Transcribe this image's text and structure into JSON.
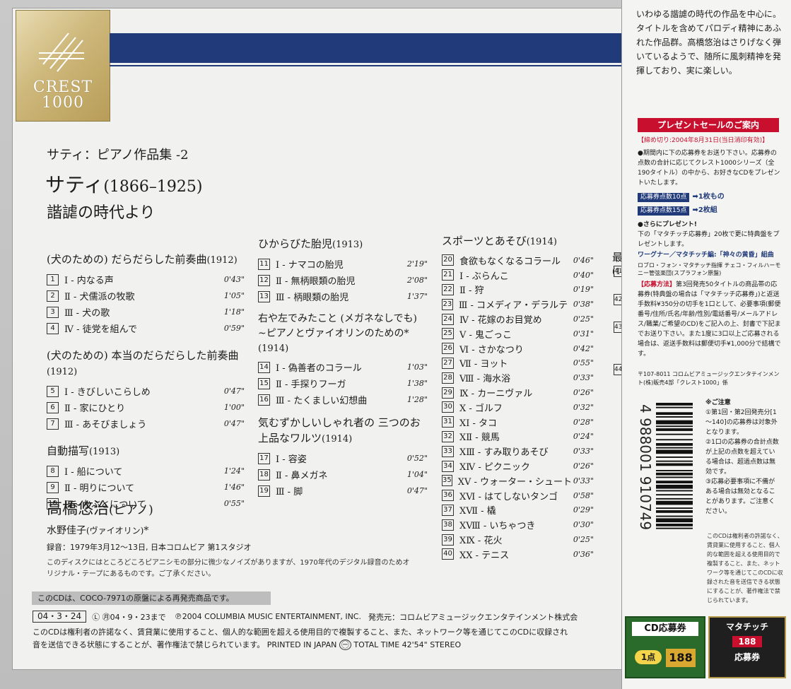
{
  "logo": {
    "line1": "CREST",
    "line2": "1000"
  },
  "album": {
    "series_title": "サティ：ピアノ作品集 -2",
    "composer": "サティ",
    "years": "(1866–1925)",
    "title": "諧謔の時代より"
  },
  "columns": [
    {
      "works": [
        {
          "title": "(犬のための) だらだらした前奏曲",
          "year": "(1912)",
          "tracks": [
            {
              "num": "1",
              "name": "Ⅰ - 内なる声",
              "time": "0'43\""
            },
            {
              "num": "2",
              "name": "Ⅱ - 犬儒派の牧歌",
              "time": "1'05\""
            },
            {
              "num": "3",
              "name": "Ⅲ - 犬の歌",
              "time": "1'18\""
            },
            {
              "num": "4",
              "name": "Ⅳ - 徒党を組んで",
              "time": "0'59\""
            }
          ]
        },
        {
          "title": "(犬のための) 本当のだらだらした前奏曲",
          "year": "(1912)",
          "tracks": [
            {
              "num": "5",
              "name": "Ⅰ - きびしいこらしめ",
              "time": "0'47\""
            },
            {
              "num": "6",
              "name": "Ⅱ - 家にひとり",
              "time": "1'00\""
            },
            {
              "num": "7",
              "name": "Ⅲ - あそびましょう",
              "time": "0'47\""
            }
          ]
        },
        {
          "title": "自動描写",
          "year": "(1913)",
          "tracks": [
            {
              "num": "8",
              "name": "Ⅰ - 船について",
              "time": "1'24\""
            },
            {
              "num": "9",
              "name": "Ⅱ - 明りについて",
              "time": "1'46\""
            },
            {
              "num": "10",
              "name": "Ⅲ - かぶとについて",
              "time": "0'55\""
            }
          ]
        }
      ]
    },
    {
      "works": [
        {
          "title": "ひからびた胎児",
          "year": "(1913)",
          "tracks": [
            {
              "num": "11",
              "name": "Ⅰ - ナマコの胎児",
              "time": "2'19\""
            },
            {
              "num": "12",
              "name": "Ⅱ - 無柄眼類の胎児",
              "time": "2'08\""
            },
            {
              "num": "13",
              "name": "Ⅲ - 柄眼類の胎児",
              "time": "1'37\""
            }
          ]
        },
        {
          "title": "右や左でみたこと (メガネなしでも) ~ピアノとヴァイオリンのための*",
          "year": "(1914)",
          "tracks": [
            {
              "num": "14",
              "name": "Ⅰ - 偽善者のコラール",
              "time": "1'03\""
            },
            {
              "num": "15",
              "name": "Ⅱ - 手探りフーガ",
              "time": "1'38\""
            },
            {
              "num": "16",
              "name": "Ⅲ - たくましい幻想曲",
              "time": "1'28\""
            }
          ]
        },
        {
          "title": "気むずかしいしゃれ者の 三つのお上品なワルツ",
          "year": "(1914)",
          "tracks": [
            {
              "num": "17",
              "name": "Ⅰ - 容姿",
              "time": "0'52\""
            },
            {
              "num": "18",
              "name": "Ⅱ - 鼻メガネ",
              "time": "1'04\""
            },
            {
              "num": "19",
              "name": "Ⅲ - 脚",
              "time": "0'47\""
            }
          ]
        }
      ]
    },
    {
      "works": [
        {
          "title": "スポーツとあそび",
          "year": "(1914)",
          "tracks": [
            {
              "num": "20",
              "name": "食欲もなくなるコラール",
              "time": "0'46\""
            },
            {
              "num": "21",
              "name": "Ⅰ - ぶらんこ",
              "time": "0'40\""
            },
            {
              "num": "22",
              "name": "Ⅱ - 狩",
              "time": "0'19\""
            },
            {
              "num": "23",
              "name": "Ⅲ - コメディア・デラルテ",
              "time": "0'38\""
            },
            {
              "num": "24",
              "name": "Ⅳ - 花嫁のお目覚め",
              "time": "0'25\""
            },
            {
              "num": "25",
              "name": "Ⅴ - 鬼ごっこ",
              "time": "0'31\""
            },
            {
              "num": "26",
              "name": "Ⅵ - さかなつり",
              "time": "0'42\""
            },
            {
              "num": "27",
              "name": "Ⅶ - ヨット",
              "time": "0'55\""
            },
            {
              "num": "28",
              "name": "Ⅷ - 海水浴",
              "time": "0'33\""
            },
            {
              "num": "29",
              "name": "Ⅸ - カーニヴァル",
              "time": "0'26\""
            },
            {
              "num": "30",
              "name": "Ⅹ - ゴルフ",
              "time": "0'32\""
            },
            {
              "num": "31",
              "name": "ⅩⅠ - タコ",
              "time": "0'28\""
            },
            {
              "num": "32",
              "name": "ⅩⅡ - 競馬",
              "time": "0'24\""
            },
            {
              "num": "33",
              "name": "ⅩⅢ - すみ取りあそび",
              "time": "0'33\""
            },
            {
              "num": "34",
              "name": "ⅩⅣ - ピクニック",
              "time": "0'26\""
            },
            {
              "num": "35",
              "name": "ⅩⅤ - ウォーター・シュート",
              "time": "0'33\""
            },
            {
              "num": "36",
              "name": "ⅩⅥ - はてしないタンゴ",
              "time": "0'58\""
            },
            {
              "num": "37",
              "name": "ⅩⅦ - 橇",
              "time": "0'29\""
            },
            {
              "num": "38",
              "name": "ⅩⅧ - いちゃつき",
              "time": "0'30\""
            },
            {
              "num": "39",
              "name": "ⅩⅨ - 花火",
              "time": "0'25\""
            },
            {
              "num": "40",
              "name": "ⅩⅩ - テニス",
              "time": "0'36\""
            }
          ]
        }
      ]
    }
  ],
  "partial_column": {
    "title": "最",
    "year": "(1",
    "nums": [
      "41",
      "42",
      "43",
      "44"
    ]
  },
  "performer": {
    "name": "高橋悠治",
    "role": "(ピアノ)"
  },
  "violinist": {
    "name": "水野佳子",
    "role": "(ヴァイオリン)",
    "mark": "*"
  },
  "recording": "録音：1979年3月12～13日, 日本コロムビア 第1スタジオ",
  "noise_note": "このディスクにはところどころピアニシモの部分に微少なノイズがありますが、1970年代のデジタル録音のためオリジナル・テープにあるものです。ご了承ください。",
  "reissue_note": "このCDは、COCO-7971の原盤による再発売商品です。",
  "footer": {
    "date": "04・3・24",
    "rental": "Ⓛ ㊊04・9・23まで",
    "copyright": "℗2004 COLUMBIA MUSIC ENTERTAINMENT, INC.",
    "seller": "発売元：コロムビアミュージックエンタテインメント株式会",
    "legal1": "このCDは権利者の許諾なく、賃貸業に使用すること、個人的な範囲を超える使用目的で複製すること、また、ネットワーク等を通じてこのCDに収録され",
    "legal2": "音を送信できる状態にすることが、著作権法で禁じられています。 PRINTED IN JAPAN",
    "mark": "㊀",
    "tail": "TOTAL TIME 42'54\"  STEREO"
  },
  "obi": {
    "description": "いわゆる諧謔の時代の作品を中心に。タイトルを含めてパロディ精神にあふれた作品群。高橋悠治はさりげなく弾いているようで、随所に風刺精神を発揮しており、実に楽しい。",
    "present_header": "プレゼントセールのご案内",
    "deadline": "【締め切り:2004年8月31日(当日消印有効)】",
    "entry": "●期間内に下の応募券をお送り下さい。応募券の点数の合計に応じてクレスト1000シリーズ（全190タイトル）の中から、お好きなCDをプレゼントいたします。",
    "tier1_tag": "応募券点数10点",
    "tier1_reward": "➡1枚もの",
    "tier2_tag": "応募券点数15点",
    "tier2_reward": "➡2枚組",
    "more_present": "●さらにプレゼント!",
    "more_text": "下の「マタチッチ応募券」20枚で更に特典盤をプレゼントします。",
    "wagner": "ワーグナー／マタチッチ編:「神々の黄昏」組曲",
    "wagner_credit": "ロブロ・フォン・マタチッチ指揮 チェコ・フィルハーモニー管弦楽団(スプラフォン原盤)",
    "method_label": "【応募方法】",
    "method_text": "第3回発売50タイトルの商品帯の応募券(特典盤の場合は「マタチッチ応募券」)と返送手数料¥350分の切手を1口として、必要事項(郵便番号/住所/氏名/年齢/性別/電話番号/メールアドレス/職業/ご希望のCD)をご記入の上、封書で下記までお送り下さい。また1度に3口以上ご応募される場合は、返送手数料は郵便切手¥1,000分で結構です。",
    "address": "〒107-8011 コロムビアミュージックエンタテインメント(株)販売4部「クレスト1000」係",
    "caution_title": "※ご注意",
    "caution1": "①第1回・第2回発売分[1～140]の応募券は対象外となります。",
    "caution2": "②1口の応募券の合計点数が上記の点数を超えている場合は、超過点数は無効です。",
    "caution3": "③応募必要事項に不備がある場合は無効となることがあります。ご注意ください。",
    "legal": "このCDは権利者の許諾なく、賃貸業に使用すること、個人的な範囲を超える使用目的で複製すること、また、ネットワーク等を通じてこのCDに収録された音を送信できる状態にすることが、著作権法で禁じられています。",
    "barcode_digits": "4 988001 910749",
    "coupon_title": "CD応募券",
    "coupon_points": "1点",
    "coupon_number": "188",
    "coupon2_title": "マタチッチ",
    "coupon2_number": "188",
    "coupon2_label": "応募券"
  },
  "colors": {
    "navy": "#203a7a",
    "red": "#c8102e",
    "gold": "#c8b070",
    "green": "#2a6a2a"
  }
}
